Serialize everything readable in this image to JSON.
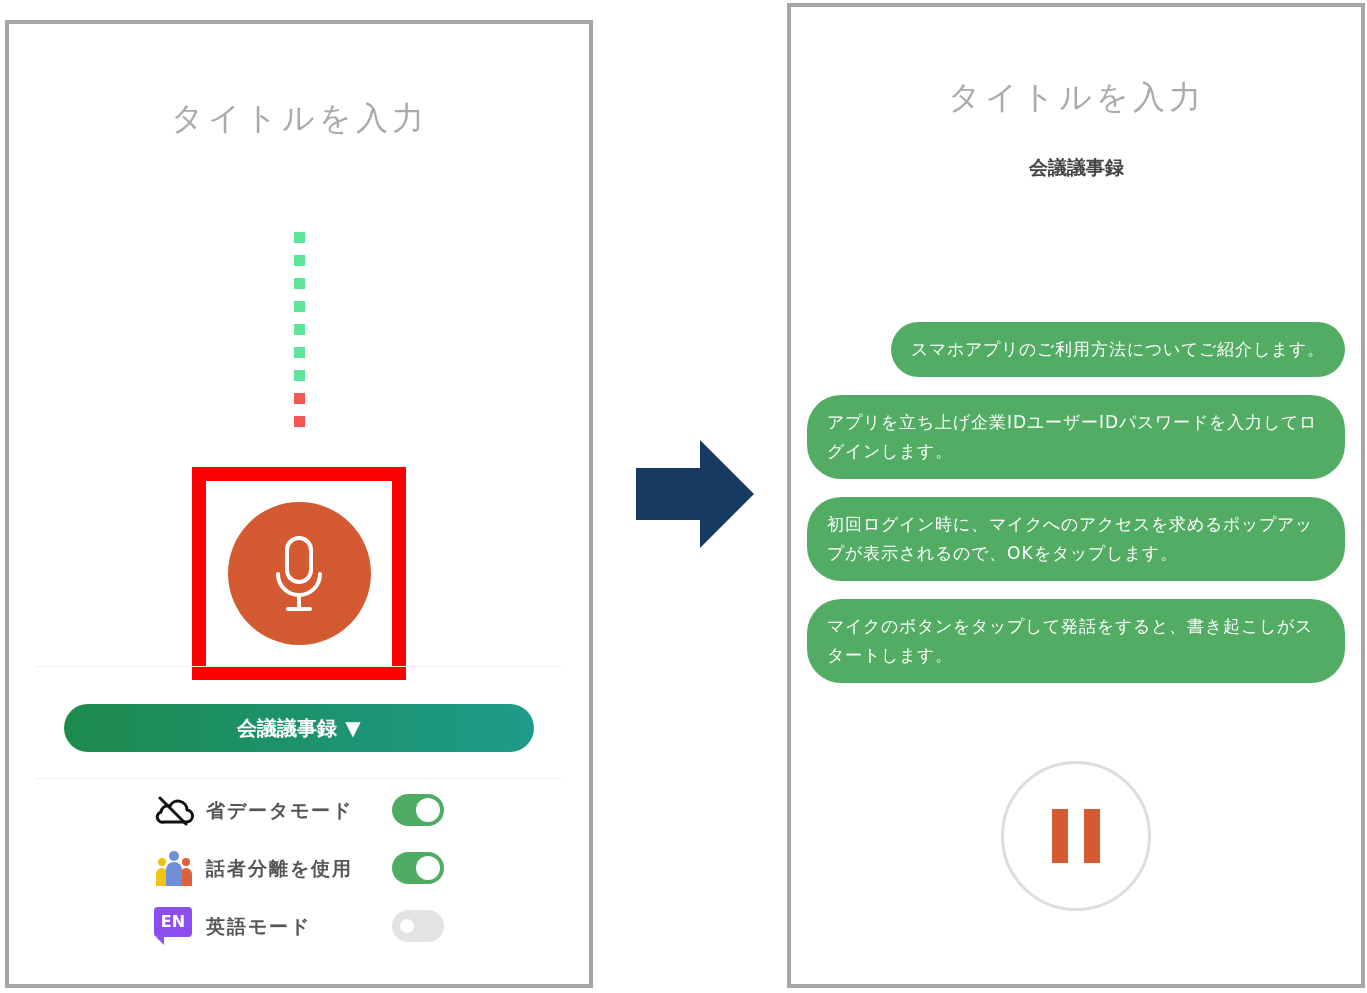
{
  "left_screen": {
    "title_placeholder": "タイトルを入力",
    "level_meter": [
      {
        "color": "#5ee39a"
      },
      {
        "color": "#5ee39a"
      },
      {
        "color": "#5ee39a"
      },
      {
        "color": "#5ee39a"
      },
      {
        "color": "#5ee39a"
      },
      {
        "color": "#5ee39a"
      },
      {
        "color": "#5ee39a"
      },
      {
        "color": "#f25656"
      },
      {
        "color": "#f25656"
      }
    ],
    "mic_button": {
      "highlighted": true
    },
    "template_button": {
      "label": "会議議事録",
      "caret": "▼"
    },
    "settings": [
      {
        "kind": "cloud",
        "label": "省データモード",
        "on": true
      },
      {
        "kind": "people",
        "label": "話者分離を使用",
        "on": true
      },
      {
        "kind": "badge",
        "badge": "EN",
        "label": "英語モード",
        "on": false
      }
    ]
  },
  "right_screen": {
    "title_placeholder": "タイトルを入力",
    "template": "会議議事録",
    "messages": [
      "スマホアプリのご利用方法についてご紹介します。",
      "アプリを立ち上げ企業IDユーザーIDパスワードを入力してログインします。",
      "初回ログイン時に、マイクへのアクセスを求めるポップアップが表示されるので、OKをタップします。",
      "マイクのボタンをタップして発話をすると、書き起こしがスタートします。"
    ]
  }
}
